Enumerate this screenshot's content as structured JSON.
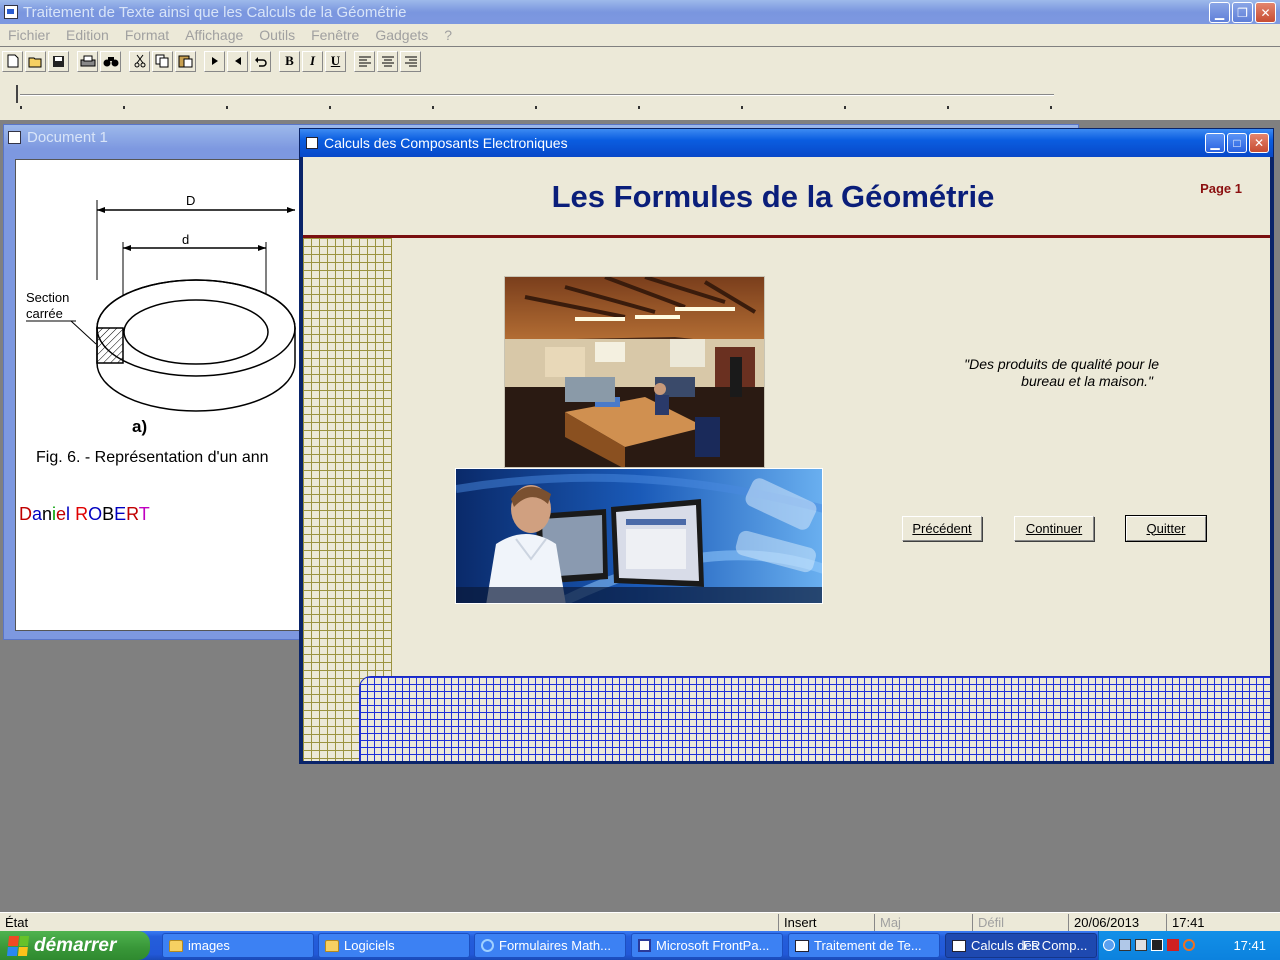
{
  "app": {
    "title": "Traitement de Texte ainsi que les Calculs de la Géométrie",
    "menu": [
      "Fichier",
      "Edition",
      "Format",
      "Affichage",
      "Outils",
      "Fenêtre",
      "Gadgets",
      "?"
    ]
  },
  "toolbar": {
    "bold": "B",
    "italic": "I",
    "underline": "U"
  },
  "document": {
    "title": "Document 1",
    "figure": {
      "outer_label": "D",
      "inner_label": "d",
      "section_line1": "Section",
      "section_line2": "carrée",
      "sub_label": "a)"
    },
    "caption": "Fig. 6. - Représentation d'un ann",
    "author_letters": [
      {
        "ch": "D",
        "color": "#c00000"
      },
      {
        "ch": "a",
        "color": "#0000c0"
      },
      {
        "ch": "n",
        "color": "#000000"
      },
      {
        "ch": "i",
        "color": "#00a000"
      },
      {
        "ch": "e",
        "color": "#c00000"
      },
      {
        "ch": "l",
        "color": "#0000c0"
      },
      {
        "ch": " ",
        "color": "#000000"
      },
      {
        "ch": "R",
        "color": "#e00000"
      },
      {
        "ch": "O",
        "color": "#0000c0"
      },
      {
        "ch": "B",
        "color": "#000000"
      },
      {
        "ch": "E",
        "color": "#0000c0"
      },
      {
        "ch": "R",
        "color": "#c00000"
      },
      {
        "ch": "T",
        "color": "#c000c0"
      }
    ]
  },
  "dialog": {
    "title": "Calculs des Composants Electroniques",
    "heading": "Les Formules de la Géométrie",
    "page_label": "Page 1",
    "quote_line1": "\"Des produits de qualité pour le",
    "quote_line2": "bureau et la maison.\"",
    "buttons": {
      "previous": "Précédent",
      "continue": "Continuer",
      "quit": "Quitter"
    }
  },
  "statusbar": {
    "state": "État",
    "insert": "Insert",
    "caps": "Maj",
    "scroll": "Défil",
    "date": "20/06/2013",
    "time": "17:41"
  },
  "taskbar": {
    "start": "démarrer",
    "tasks": [
      "images",
      "Logiciels",
      "Formulaires Math...",
      "Microsoft FrontPa...",
      "Traitement de Te...",
      "Calculs des Comp..."
    ],
    "lang": "FR",
    "clock": "17:41"
  },
  "colors": {
    "heading": "#0a1e7a",
    "page_label": "#8b1010",
    "grid_left": "#9b9340",
    "grid_bottom": "#2030d8"
  }
}
